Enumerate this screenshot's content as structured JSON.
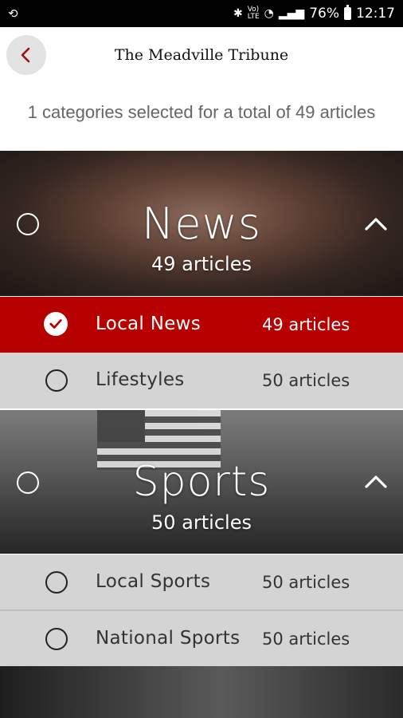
{
  "status_bar": {
    "left_icon": "scan-icon",
    "icons": [
      "bluetooth-icon",
      "volte-icon",
      "wifi-icon",
      "signal-icon"
    ],
    "battery": "76%",
    "time": "12:17"
  },
  "header": {
    "back_icon": "chevron-left-icon",
    "title": "The Meadville Tribune"
  },
  "summary": "1 categories selected for a total of 49 articles",
  "categories": [
    {
      "name": "News",
      "count": "49 articles",
      "expanded": true,
      "selected": false,
      "subcategories": [
        {
          "name": "Local News",
          "count": "49 articles",
          "selected": true
        },
        {
          "name": "Lifestyles",
          "count": "50 articles",
          "selected": false
        }
      ]
    },
    {
      "name": "Sports",
      "count": "50 articles",
      "expanded": true,
      "selected": false,
      "subcategories": [
        {
          "name": "Local Sports",
          "count": "50 articles",
          "selected": false
        },
        {
          "name": "National Sports",
          "count": "50 articles",
          "selected": false
        }
      ]
    }
  ],
  "colors": {
    "accent": "#b70000",
    "row_bg": "#d4d4d4",
    "back_button_bg": "#e3e3e3"
  }
}
